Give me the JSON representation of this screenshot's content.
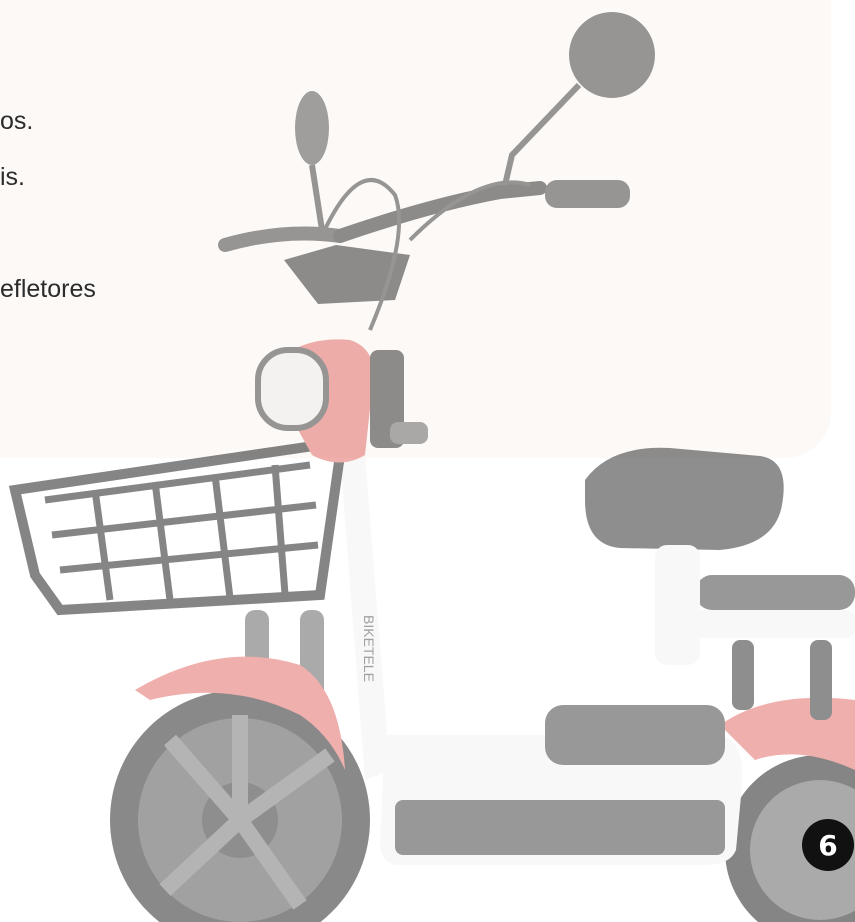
{
  "text_lines": [
    {
      "text": "os."
    },
    {
      "text": "is."
    },
    {
      "text": "efletores"
    }
  ],
  "badge": {
    "page_number": "6"
  },
  "bike": {
    "brand_text": "BIKETELE"
  },
  "colors": {
    "panel_background": "#fcf9f6",
    "accent_red": "#e26f6a",
    "frame_white": "#f4f4f4",
    "dark_parts": "#555555",
    "badge_background": "#111111"
  }
}
